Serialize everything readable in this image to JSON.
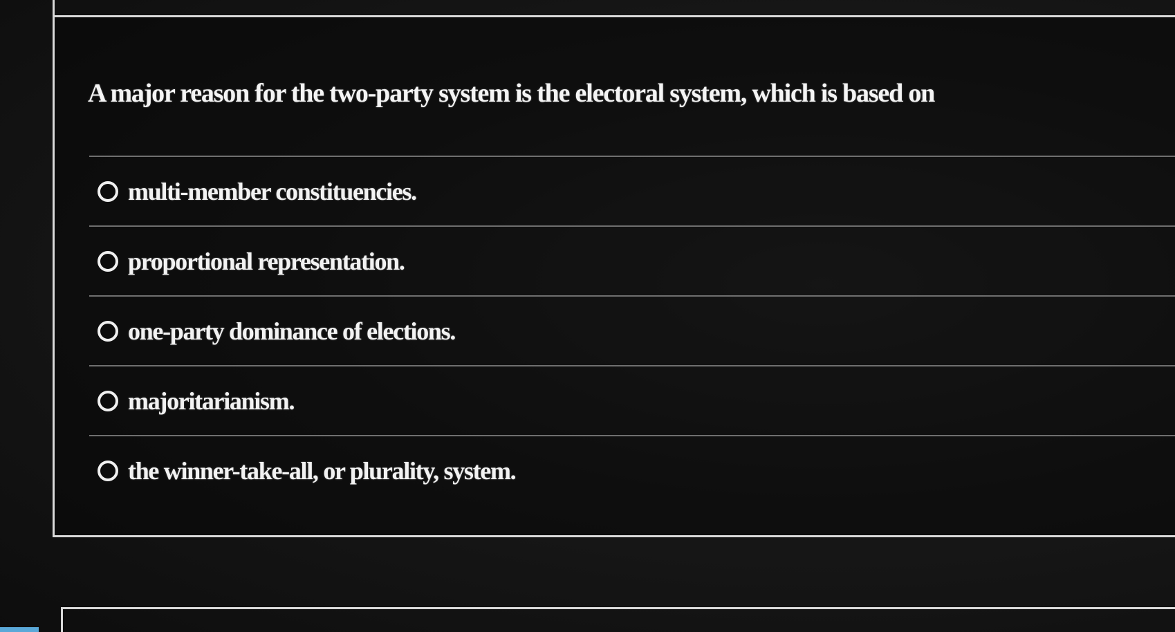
{
  "question": {
    "text": "A major reason for the two-party system is the electoral system, which is based on"
  },
  "options": [
    {
      "label": "multi-member constituencies.",
      "selected": false
    },
    {
      "label": "proportional representation.",
      "selected": false
    },
    {
      "label": "one-party dominance of elections.",
      "selected": false
    },
    {
      "label": "majoritarianism.",
      "selected": false
    },
    {
      "label": "the winner-take-all, or plurality, system.",
      "selected": false
    }
  ],
  "colors": {
    "background": "#141414",
    "text": "#f2f2f2",
    "border": "#d9d9d9",
    "divider": "#6f6f6f",
    "accent_tab": "#5aa8d8"
  }
}
